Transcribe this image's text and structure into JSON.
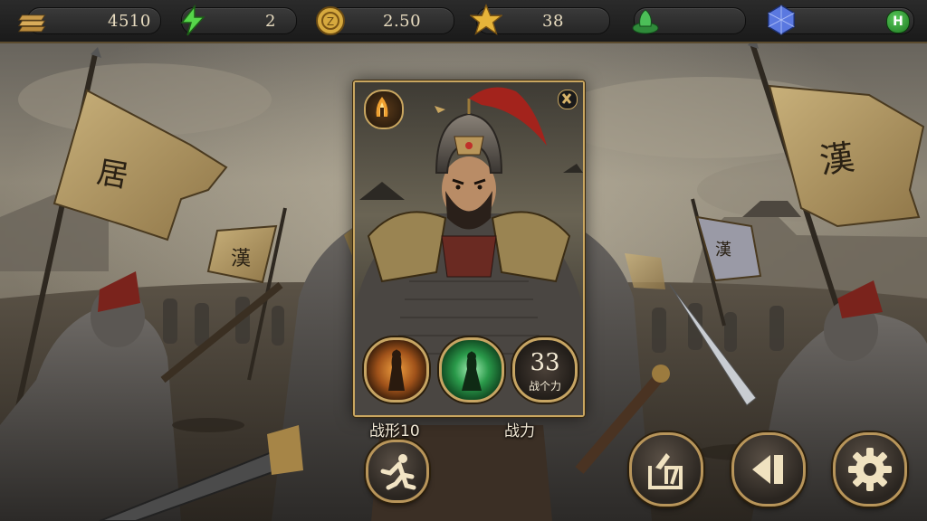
{
  "resources": [
    {
      "name": "gold-bars",
      "icon": "gold-bars-icon",
      "value": "4510"
    },
    {
      "name": "energy",
      "icon": "lightning-icon",
      "value": "2"
    },
    {
      "name": "coin",
      "icon": "coin-icon",
      "value": "2.50"
    },
    {
      "name": "star",
      "icon": "star-icon",
      "value": "38"
    },
    {
      "name": "jade",
      "icon": "green-token-icon",
      "value": ""
    },
    {
      "name": "gem",
      "icon": "blue-gem-icon",
      "value": "",
      "add_label": "H"
    }
  ],
  "banners": {
    "left_large": "居",
    "left_small": "漢",
    "right_large": "漢",
    "right_small": "漢"
  },
  "hero_card": {
    "top_left_icon": "flame-warrior-icon",
    "top_right_icon": "x-badge-icon",
    "skill1_icon": "warrior-fire-icon",
    "skill2_icon": "warrior-jade-icon",
    "power_value": "33",
    "power_sub": "战个力",
    "label_left": "战形10",
    "label_right": "战力"
  },
  "buttons": {
    "action_icon": "running-figure-icon",
    "share_icon": "share-box-icon",
    "back_icon": "rewind-icon",
    "settings_icon": "gear-icon"
  },
  "colors": {
    "gold_border": "#c9a660",
    "bar_bg": "#262626",
    "plus_green": "#2e9a31"
  }
}
